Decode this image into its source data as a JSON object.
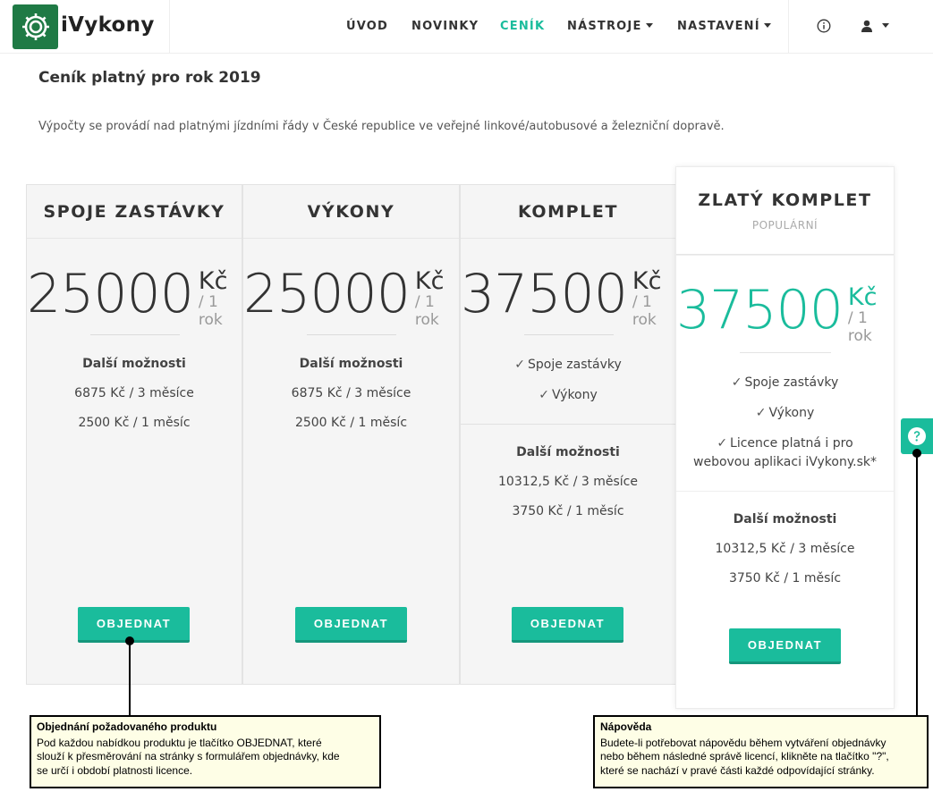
{
  "brand": {
    "name": "iVykony"
  },
  "nav": {
    "items": [
      {
        "label": "ÚVOD",
        "active": false
      },
      {
        "label": "NOVINKY",
        "active": false
      },
      {
        "label": "CENÍK",
        "active": true
      },
      {
        "label": "NÁSTROJE",
        "active": false,
        "dropdown": true
      },
      {
        "label": "NASTAVENÍ",
        "active": false,
        "dropdown": true
      }
    ],
    "info_icon": "info-icon",
    "user_icon": "user-icon"
  },
  "page": {
    "title": "Ceník platný pro rok 2019",
    "description": "Výpočty se provádí nad platnými jízdními řády v České republice ve veřejné linkové/autobusové a železniční dopravě."
  },
  "cards": [
    {
      "title": "SPOJE ZASTÁVKY",
      "price": "25000",
      "currency": "Kč",
      "period": "/ 1 rok",
      "features": [],
      "more_title": "Další možnosti",
      "more": [
        "6875 Kč / 3 měsíce",
        "2500 Kč / 1 měsíc"
      ],
      "button": "OBJEDNAT"
    },
    {
      "title": "VÝKONY",
      "price": "25000",
      "currency": "Kč",
      "period": "/ 1 rok",
      "features": [],
      "more_title": "Další možnosti",
      "more": [
        "6875 Kč / 3 měsíce",
        "2500 Kč / 1 měsíc"
      ],
      "button": "OBJEDNAT"
    },
    {
      "title": "KOMPLET",
      "price": "37500",
      "currency": "Kč",
      "period": "/ 1 rok",
      "features": [
        "Spoje zastávky",
        "Výkony"
      ],
      "more_title": "Další možnosti",
      "more": [
        "10312,5 Kč / 3 měsíce",
        "3750 Kč / 1 měsíc"
      ],
      "button": "OBJEDNAT"
    },
    {
      "title": "ZLATÝ KOMPLET",
      "badge": "POPULÁRNÍ",
      "price": "37500",
      "currency": "Kč",
      "period": "/ 1 rok",
      "features": [
        "Spoje zastávky",
        "Výkony",
        "Licence platná i pro",
        "webovou aplikaci iVykony.sk*"
      ],
      "more_title": "Další možnosti",
      "more": [
        "10312,5 Kč / 3 měsíce",
        "3750 Kč / 1 měsíc"
      ],
      "button": "OBJEDNAT"
    }
  ],
  "help_tab": {
    "icon": "question-circle-icon"
  },
  "annotations": {
    "order": {
      "title": "Objednání požadovaného produktu",
      "lines": [
        "Pod každou nabídkou produktu je tlačítko OBJEDNAT, které",
        "slouží k přesměrování na stránky s formulářem objednávky, kde",
        "se určí i období platnosti licence."
      ]
    },
    "help": {
      "title": "Nápověda",
      "lines": [
        "Budete-li potřebovat nápovědu během vytváření objednávky",
        "nebo během následné správě licencí, klikněte na tlačítko \"?\",",
        "které se nachází v pravé části každé odpovídající stránky."
      ]
    }
  },
  "colors": {
    "accent": "#1abc9c",
    "logo_bg": "#1f7a45",
    "callout_bg": "#fefee6"
  }
}
